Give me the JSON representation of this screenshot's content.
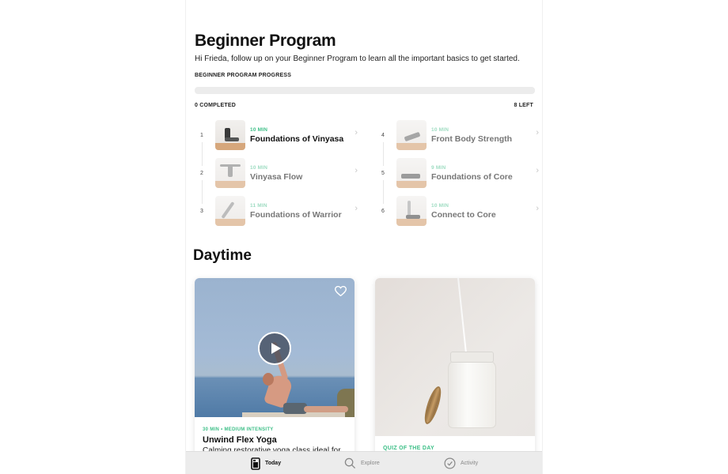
{
  "header": {
    "title": "Beginner Program",
    "subtitle": "Hi Frieda, follow up on your Beginner Program to learn all the important basics to get started.",
    "progress_label": "BEGINNER PROGRAM PROGRESS",
    "progress_fraction": 0,
    "completed_label": "0 COMPLETED",
    "left_label": "8 LEFT"
  },
  "lessons": [
    {
      "number": "1",
      "duration": "10 MIN",
      "title": "Foundations of Vinyasa",
      "active": true
    },
    {
      "number": "2",
      "duration": "10 MIN",
      "title": "Vinyasa Flow",
      "active": false
    },
    {
      "number": "3",
      "duration": "11 MIN",
      "title": "Foundations of Warrior",
      "active": false
    },
    {
      "number": "4",
      "duration": "10 MIN",
      "title": "Front Body Strength",
      "active": false
    },
    {
      "number": "5",
      "duration": "9 MIN",
      "title": "Foundations of Core",
      "active": false
    },
    {
      "number": "6",
      "duration": "10 MIN",
      "title": "Connect to Core",
      "active": false
    }
  ],
  "daytime": {
    "section_title": "Daytime",
    "video_card": {
      "meta": "30 MIN • MEDIUM INTENSITY",
      "title": "Unwind Flex Yoga",
      "description": "Calming restorative yoga class ideal for"
    },
    "quiz_card": {
      "label": "QUIZ OF THE DAY"
    }
  },
  "tabbar": {
    "tabs": [
      {
        "label": "Today",
        "icon": "today-icon",
        "active": true
      },
      {
        "label": "Explore",
        "icon": "search-icon",
        "active": false
      },
      {
        "label": "Activity",
        "icon": "check-circle-icon",
        "active": false
      }
    ]
  },
  "colors": {
    "accent": "#3dbf87",
    "accent_dim": "#9fdcc2",
    "tabbar_bg": "#ececec"
  }
}
